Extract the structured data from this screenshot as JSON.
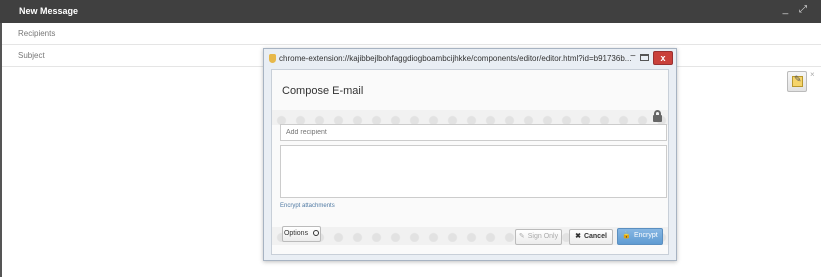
{
  "compose": {
    "window_title": "New Message",
    "recipients_label": "Recipients",
    "subject_label": "Subject",
    "controls": "_ ⤢"
  },
  "popup": {
    "url": "chrome-extension://kajibbejlbohfaggdiogboambcijhkke/components/editor/editor.html?id=b91736b...",
    "minimize": "−",
    "close": "x",
    "heading": "Compose E-mail",
    "recipient_placeholder": "Add recipient",
    "encrypt_attachments": "Encrypt attachments",
    "buttons": {
      "options": "Options",
      "sign_only": "Sign Only",
      "cancel": "Cancel",
      "encrypt": "Encrypt"
    },
    "icons": {
      "sign": "✎",
      "cancel": "✖",
      "encrypt": "🔒"
    }
  },
  "side": {
    "close": "×"
  },
  "colors": {
    "header_bg": "#404040",
    "encrypt_blue": "#6ea6da",
    "close_red": "#c9403a"
  }
}
